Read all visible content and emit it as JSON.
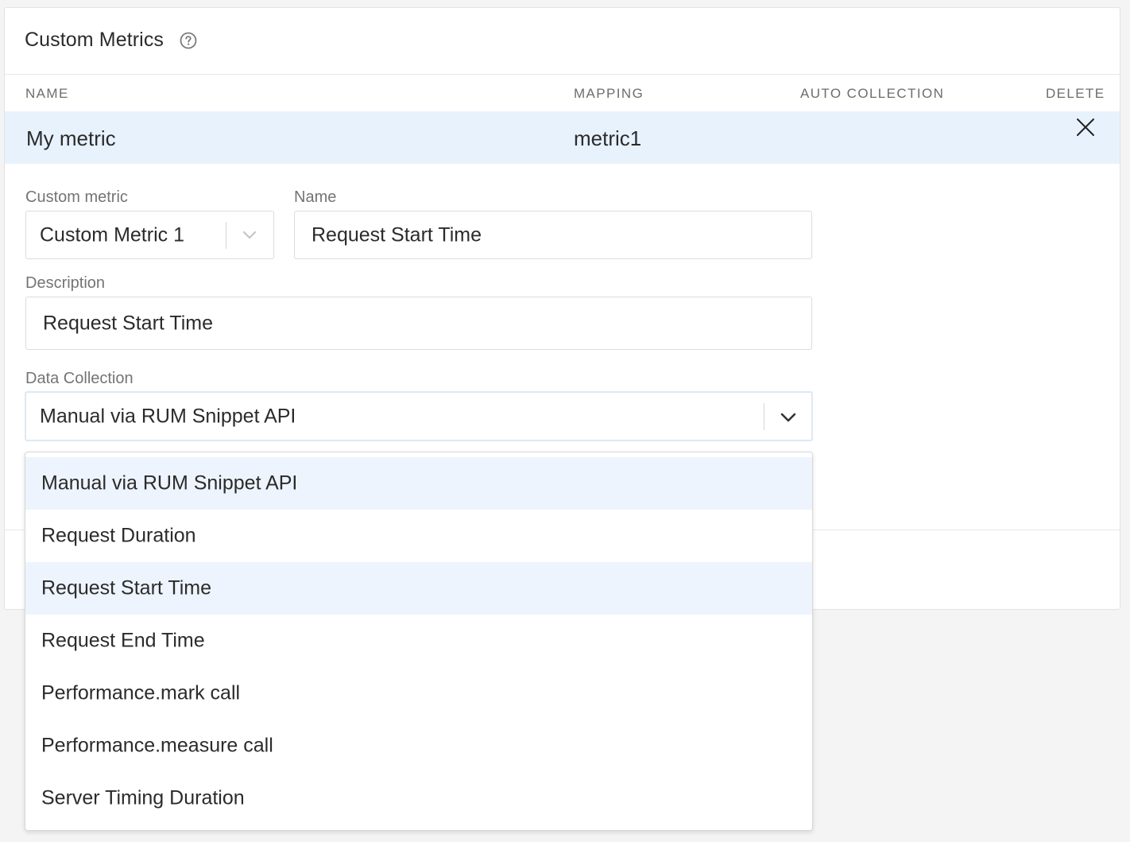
{
  "card": {
    "title": "Custom Metrics",
    "help_icon": "question-circle-icon"
  },
  "table": {
    "columns": [
      "NAME",
      "MAPPING",
      "AUTO COLLECTION",
      "DELETE"
    ],
    "rows": [
      {
        "name": "My metric",
        "mapping": "metric1",
        "auto_collection": "",
        "delete_icon": "close-icon"
      }
    ]
  },
  "form": {
    "custom_metric": {
      "label": "Custom metric",
      "value": "Custom Metric 1"
    },
    "name": {
      "label": "Name",
      "value": "Request Start Time"
    },
    "description": {
      "label": "Description",
      "value": "Request Start Time"
    },
    "data_collection": {
      "label": "Data Collection",
      "value": "Manual via RUM Snippet API",
      "options": [
        "Manual via RUM Snippet API",
        "Request Duration",
        "Request Start Time",
        "Request End Time",
        "Performance.mark call",
        "Performance.measure call",
        "Server Timing Duration"
      ]
    }
  },
  "colors": {
    "selected_row": "#e8f2fc",
    "option_highlight": "#eef4fd",
    "focus_border": "#dbe9f7"
  }
}
